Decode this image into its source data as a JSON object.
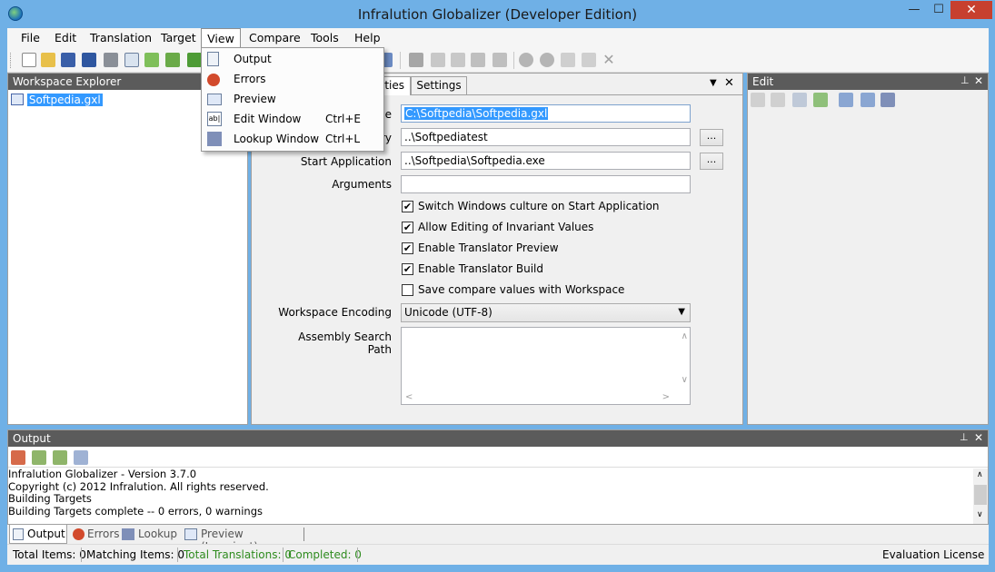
{
  "window": {
    "title": "Infralution Globalizer (Developer Edition)"
  },
  "window_controls": {
    "minimize": "—",
    "maximize": "☐",
    "close": "✕"
  },
  "menubar": [
    {
      "label": "File"
    },
    {
      "label": "Edit"
    },
    {
      "label": "Translation"
    },
    {
      "label": "Target"
    },
    {
      "label": "View"
    },
    {
      "label": "Compare"
    },
    {
      "label": "Tools"
    },
    {
      "label": "Help"
    }
  ],
  "view_menu": [
    {
      "label": "Output",
      "shortcut": "",
      "icon": "output-icon"
    },
    {
      "label": "Errors",
      "shortcut": "",
      "icon": "errors-icon"
    },
    {
      "label": "Preview",
      "shortcut": "",
      "icon": "preview-icon"
    },
    {
      "label": "Edit Window",
      "shortcut": "Ctrl+E",
      "icon": "edit-window-icon"
    },
    {
      "label": "Lookup Window",
      "shortcut": "Ctrl+L",
      "icon": "lookup-window-icon"
    }
  ],
  "workspace_explorer": {
    "header": "Workspace Explorer",
    "item": "Softpedia.gxl"
  },
  "center": {
    "tabs": {
      "properties": "erties",
      "settings": "Settings"
    },
    "fields": {
      "file_label": "le",
      "file_value": "C:\\Softpedia\\Softpedia.gxl",
      "dir_label": "ry",
      "dir_value": "..\\Softpediatest",
      "start_label": "Start Application",
      "start_value": "..\\Softpedia\\Softpedia.exe",
      "args_label": "Arguments",
      "args_value": "",
      "browse": "...",
      "encoding_label": "Workspace Encoding",
      "encoding_value": "Unicode (UTF-8)",
      "search_label": "Assembly Search Path"
    },
    "checkboxes": [
      {
        "label": "Switch Windows culture on Start Application",
        "checked": true
      },
      {
        "label": "Allow Editing of Invariant Values",
        "checked": true
      },
      {
        "label": "Enable Translator Preview",
        "checked": true
      },
      {
        "label": "Enable Translator Build",
        "checked": true
      },
      {
        "label": "Save compare values with Workspace",
        "checked": false
      }
    ]
  },
  "edit_panel": {
    "header": "Edit"
  },
  "output": {
    "header": "Output",
    "lines": [
      "Infralution Globalizer - Version 3.7.0",
      "Copyright (c) 2012 Infralution.  All rights reserved.",
      "Building Targets",
      "Building Targets complete -- 0 errors, 0 warnings"
    ],
    "tabs": [
      "Output",
      "Errors",
      "Lookup",
      "Preview (Invariant)"
    ]
  },
  "status": {
    "total_items": "Total Items: 0",
    "matching_items": "Matching Items: 0",
    "total_translations": "Total Translations: 0",
    "completed": "Completed: 0",
    "license": "Evaluation License"
  },
  "colors": {
    "green_status": "#2e8b1e",
    "selection": "#3399ff",
    "header": "#5b5b5b",
    "title_bar": "#6fb0e6"
  }
}
